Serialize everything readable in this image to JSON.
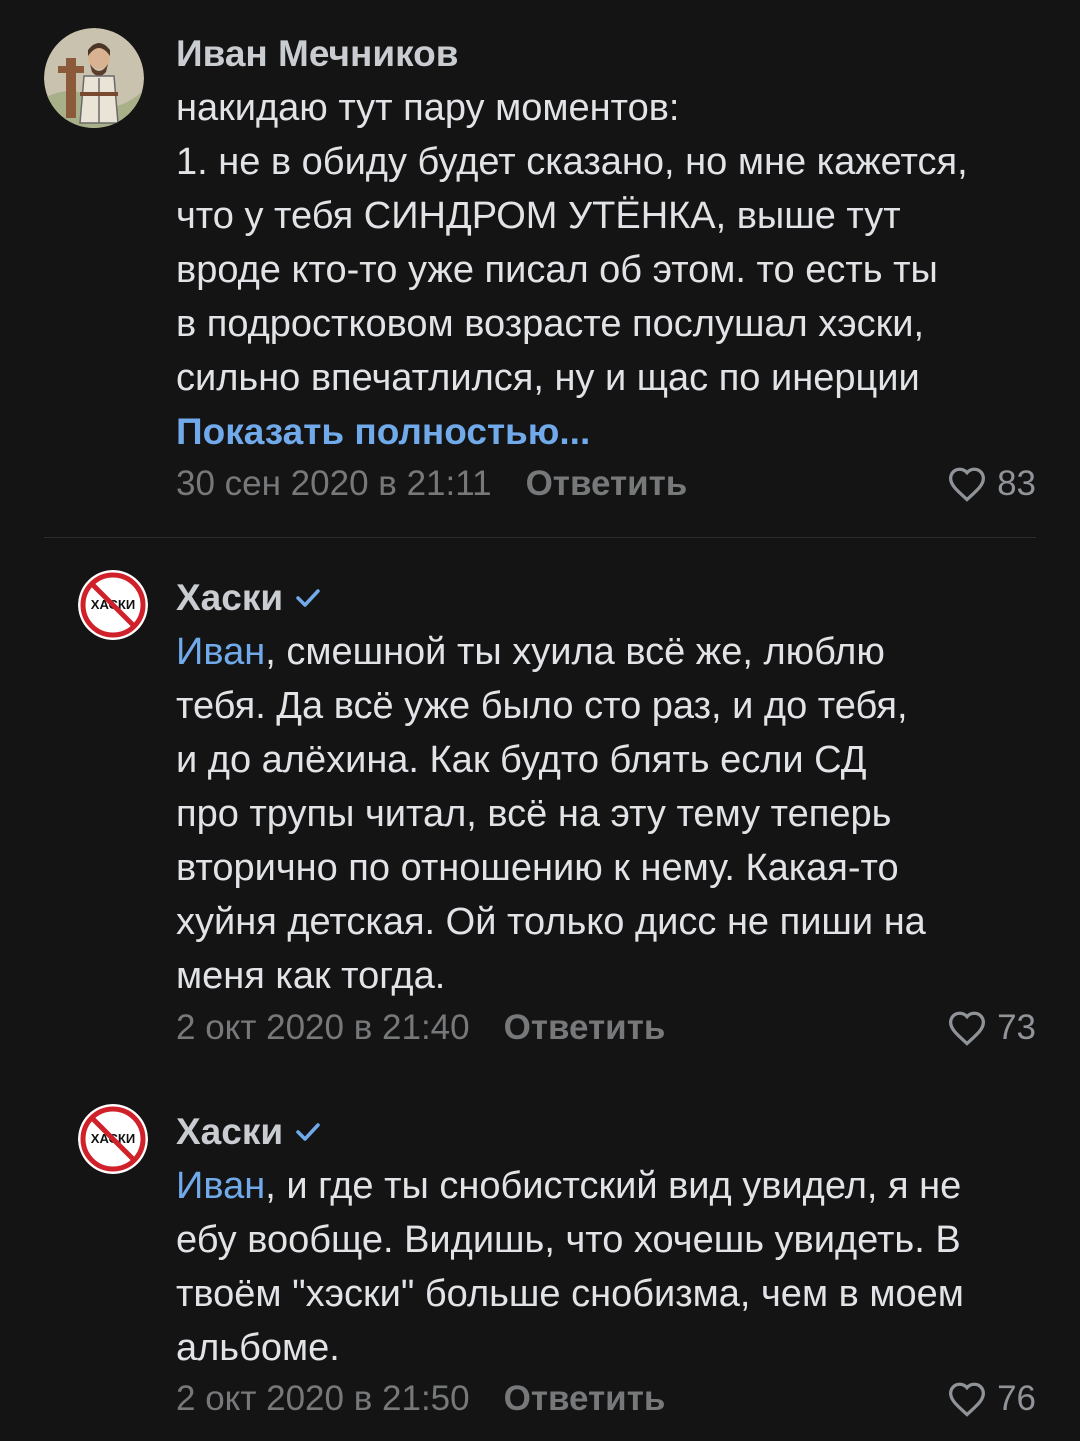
{
  "comments": [
    {
      "author": "Иван Мечников",
      "verified": false,
      "mention": "",
      "lines": [
        "накидаю тут пару моментов:",
        "1. не в обиду будет сказано, но мне кажется,",
        "что у тебя СИНДРОМ УТЁНКА, выше тут",
        "вроде кто-то уже писал об этом. то есть ты",
        "в подростковом возрасте послушал хэски,",
        "сильно впечатлился, ну и щас по инерции"
      ],
      "show_more": "Показать полностью...",
      "date": "30 сен 2020 в 21:11",
      "reply_label": "Ответить",
      "likes": "83"
    },
    {
      "author": "Хаски",
      "verified": true,
      "mention": "Иван",
      "first_line_rest": ", смешной ты хуила всё же, люблю",
      "lines": [
        "тебя. Да всё уже было сто раз, и до тебя,",
        "и до алёхина. Как будто блять если СД",
        "про трупы читал, всё на эту тему теперь",
        "вторично по отношению к нему. Какая-то",
        "хуйня детская. Ой только дисс не пиши на",
        "меня как тогда."
      ],
      "date": "2 окт 2020 в 21:40",
      "reply_label": "Ответить",
      "likes": "73"
    },
    {
      "author": "Хаски",
      "verified": true,
      "mention": "Иван",
      "first_line_rest": ", и где ты снобистский вид увидел, я не",
      "lines": [
        "ебу вообще. Видишь, что хочешь увидеть. В",
        "твоём \"хэски\" больше снобизма, чем в моем",
        "альбоме."
      ],
      "date": "2 окт 2020 в 21:50",
      "reply_label": "Ответить",
      "likes": "76"
    }
  ],
  "avatar_logo_text": "ХАСКИ",
  "colors": {
    "background": "#141414",
    "text": "#e1e3e6",
    "link": "#71aaeb",
    "secondary": "#76787a",
    "prohibition_red": "#d0212a"
  }
}
